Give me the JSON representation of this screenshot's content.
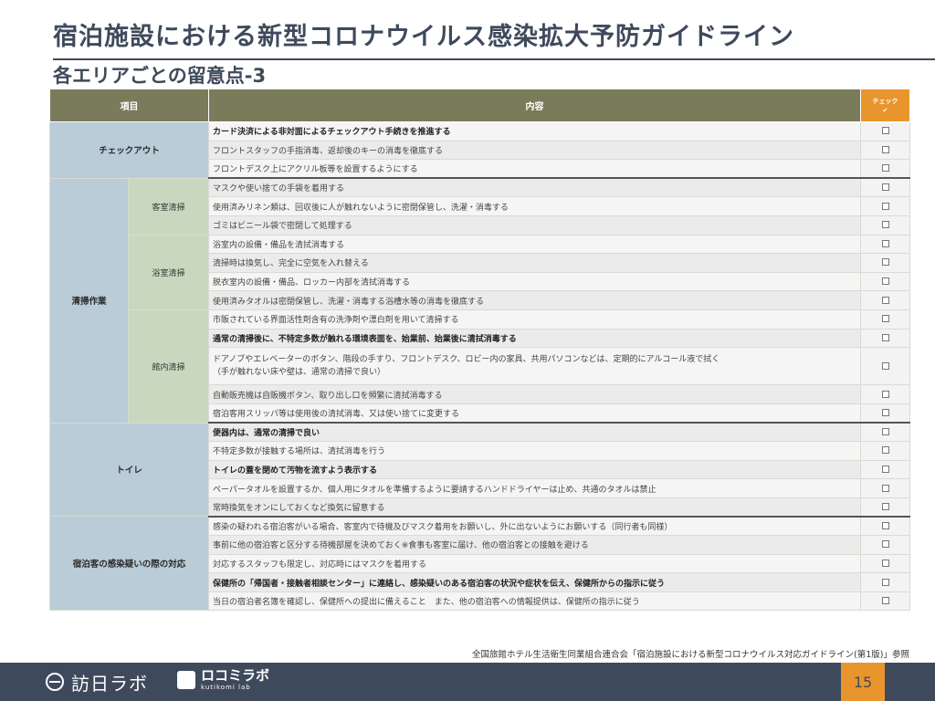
{
  "header": {
    "title": "宿泊施設における新型コロナウイルス感染拡大予防ガイドライン",
    "subtitle": "各エリアごとの留意点-3"
  },
  "table": {
    "col_item": "項目",
    "col_content": "内容",
    "col_check": "チェック",
    "col_check_mark": "✔",
    "checkout": {
      "label": "チェックアウト",
      "rows": [
        {
          "text": "カード決済による非対面によるチェックアウト手続きを推進する",
          "bold": true
        },
        {
          "text": "フロントスタッフの手指消毒、返却後のキーの消毒を徹底する",
          "bold": false
        },
        {
          "text": "フロントデスク上にアクリル板等を設置するようにする",
          "bold": false
        }
      ]
    },
    "cleaning": {
      "label": "清掃作業",
      "room_label": "客室清掃",
      "room_rows": [
        {
          "text": "マスクや使い捨ての手袋を着用する",
          "bold": false
        },
        {
          "text": "使用済みリネン類は、回収後に人が触れないように密閉保管し、洗濯・消毒する",
          "bold": false
        },
        {
          "text": "ゴミはビニール袋で密閉して処理する",
          "bold": false
        }
      ],
      "bath_label": "浴室清掃",
      "bath_rows": [
        {
          "text": "浴室内の設備・備品を清拭消毒する",
          "bold": false
        },
        {
          "text": "清掃時は換気し、完全に空気を入れ替える",
          "bold": false
        },
        {
          "text": "脱衣室内の設備・備品、ロッカー内部を清拭消毒する",
          "bold": false
        },
        {
          "text": "使用済みタオルは密閉保管し、洗濯・消毒する浴槽水等の消毒を徹底する",
          "bold": false
        }
      ],
      "hall_label": "館内清掃",
      "hall_rows": [
        {
          "text": "市販されている界面活性剤含有の洗浄剤や漂白剤を用いて清掃する",
          "bold": false
        },
        {
          "text": "通常の清掃後に、不特定多数が触れる環境表面を、始業前、始業後に清拭消毒する",
          "bold": true
        },
        {
          "text": "ドアノブやエレベーターのボタン、階段の手すり、フロントデスク、ロビー内の家具、共用パソコンなどは、定期的にアルコール液で拭く",
          "note": "（手が触れない床や壁は、通常の清掃で良い）",
          "bold": false
        },
        {
          "text": "自動販売機は自販機ボタン、取り出し口を頻繁に清拭消毒する",
          "bold": false
        },
        {
          "text": "宿泊客用スリッパ等は使用後の清拭消毒、又は使い捨てに変更する",
          "bold": false
        }
      ]
    },
    "toilet": {
      "label": "トイレ",
      "rows": [
        {
          "text": "便器内は、通常の清掃で良い",
          "bold": true
        },
        {
          "text": "不特定多数が接触する場所は、清拭消毒を行う",
          "bold": false
        },
        {
          "text": "トイレの蓋を閉めて汚物を流すよう表示する",
          "bold": true
        },
        {
          "text": "ペーパータオルを設置するか、個人用にタオルを準備するように要請するハンドドライヤーは止め、共通のタオルは禁止",
          "bold": false
        },
        {
          "text": "常時換気をオンにしておくなど換気に留意する",
          "bold": false
        }
      ]
    },
    "infection": {
      "label": "宿泊客の感染疑いの際の対応",
      "rows": [
        {
          "text": "感染の疑われる宿泊客がいる場合、客室内で待機及びマスク着用をお願いし、外に出ないようにお願いする（同行者も同様）",
          "bold": false
        },
        {
          "text": "事前に他の宿泊客と区分する待機部屋を決めておく※食事も客室に届け、他の宿泊客との接触を避ける",
          "bold": false
        },
        {
          "text": "対応するスタッフも限定し、対応時にはマスクを着用する",
          "bold": false
        },
        {
          "text": "保健所の「帰国者・接触者相談センター」に連絡し、感染疑いのある宿泊客の状況や症状を伝え、保健所からの指示に従う",
          "bold": true
        },
        {
          "text": "当日の宿泊者名簿を確認し、保健所への提出に備えること　また、他の宿泊客への情報提供は、保健所の指示に従う",
          "bold": false
        }
      ]
    }
  },
  "source": "全国旅館ホテル生活衛生同業組合連合会「宿泊施設における新型コロナウイルス対応ガイドライン(第1版)」参照",
  "footer": {
    "logo1": "訪日ラボ",
    "logo2_name": "ロコミラボ",
    "logo2_roman": "kutikomi lab",
    "page_number": "15"
  }
}
